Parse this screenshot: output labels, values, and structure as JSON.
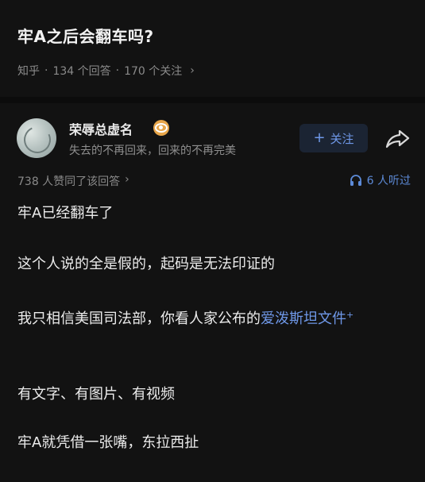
{
  "question": {
    "title": "牢A之后会翻车吗?",
    "source": "知乎",
    "answers": "134 个回答",
    "followers": "170 个关注",
    "sep": "·"
  },
  "author": {
    "name": "荣辱总虚名",
    "bio": "失去的不再回来，回来的不再完美",
    "follow_label": "关注"
  },
  "answer": {
    "votes": "738 人赞同了该回答",
    "listen": "6 人听过",
    "p1": "牢A已经翻车了",
    "p2": "这个人说的全是假的，起码是无法印证的",
    "p3_text": "我只相信美国司法部，你看人家公布的",
    "p3_link": "爱泼斯坦文件",
    "p3_link_mark": "+",
    "p4": "有文字、有图片、有视频",
    "p5": "牢A就凭借一张嘴，东拉西扯"
  },
  "colors": {
    "background": "#121212",
    "accent": "#6f98e8",
    "muted": "#8a8a8a"
  },
  "icons": [
    "chevron-right-icon",
    "verified-badge-icon",
    "plus-icon",
    "share-icon",
    "headphone-icon"
  ]
}
